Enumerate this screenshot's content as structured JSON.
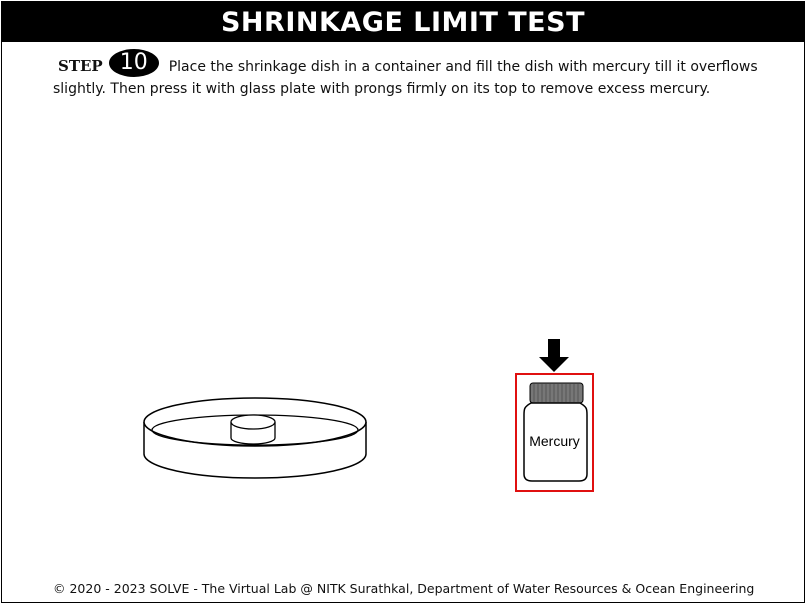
{
  "header": {
    "title": "SHRINKAGE LIMIT TEST"
  },
  "instruction": {
    "step_label": "STEP",
    "step_number": "10",
    "text": "Place the shrinkage dish in a container and fill the dish with mercury till it overflows slightly. Then press it with glass plate with prongs firmly on its top to remove excess mercury."
  },
  "apparatus": {
    "bottle_label": "Mercury",
    "highlight_color": "#e01010",
    "arrow_icon": "down-arrow-icon"
  },
  "footer": {
    "text": "© 2020 - 2023 SOLVE - The Virtual Lab @ NITK Surathkal, Department of Water Resources & Ocean Engineering"
  }
}
